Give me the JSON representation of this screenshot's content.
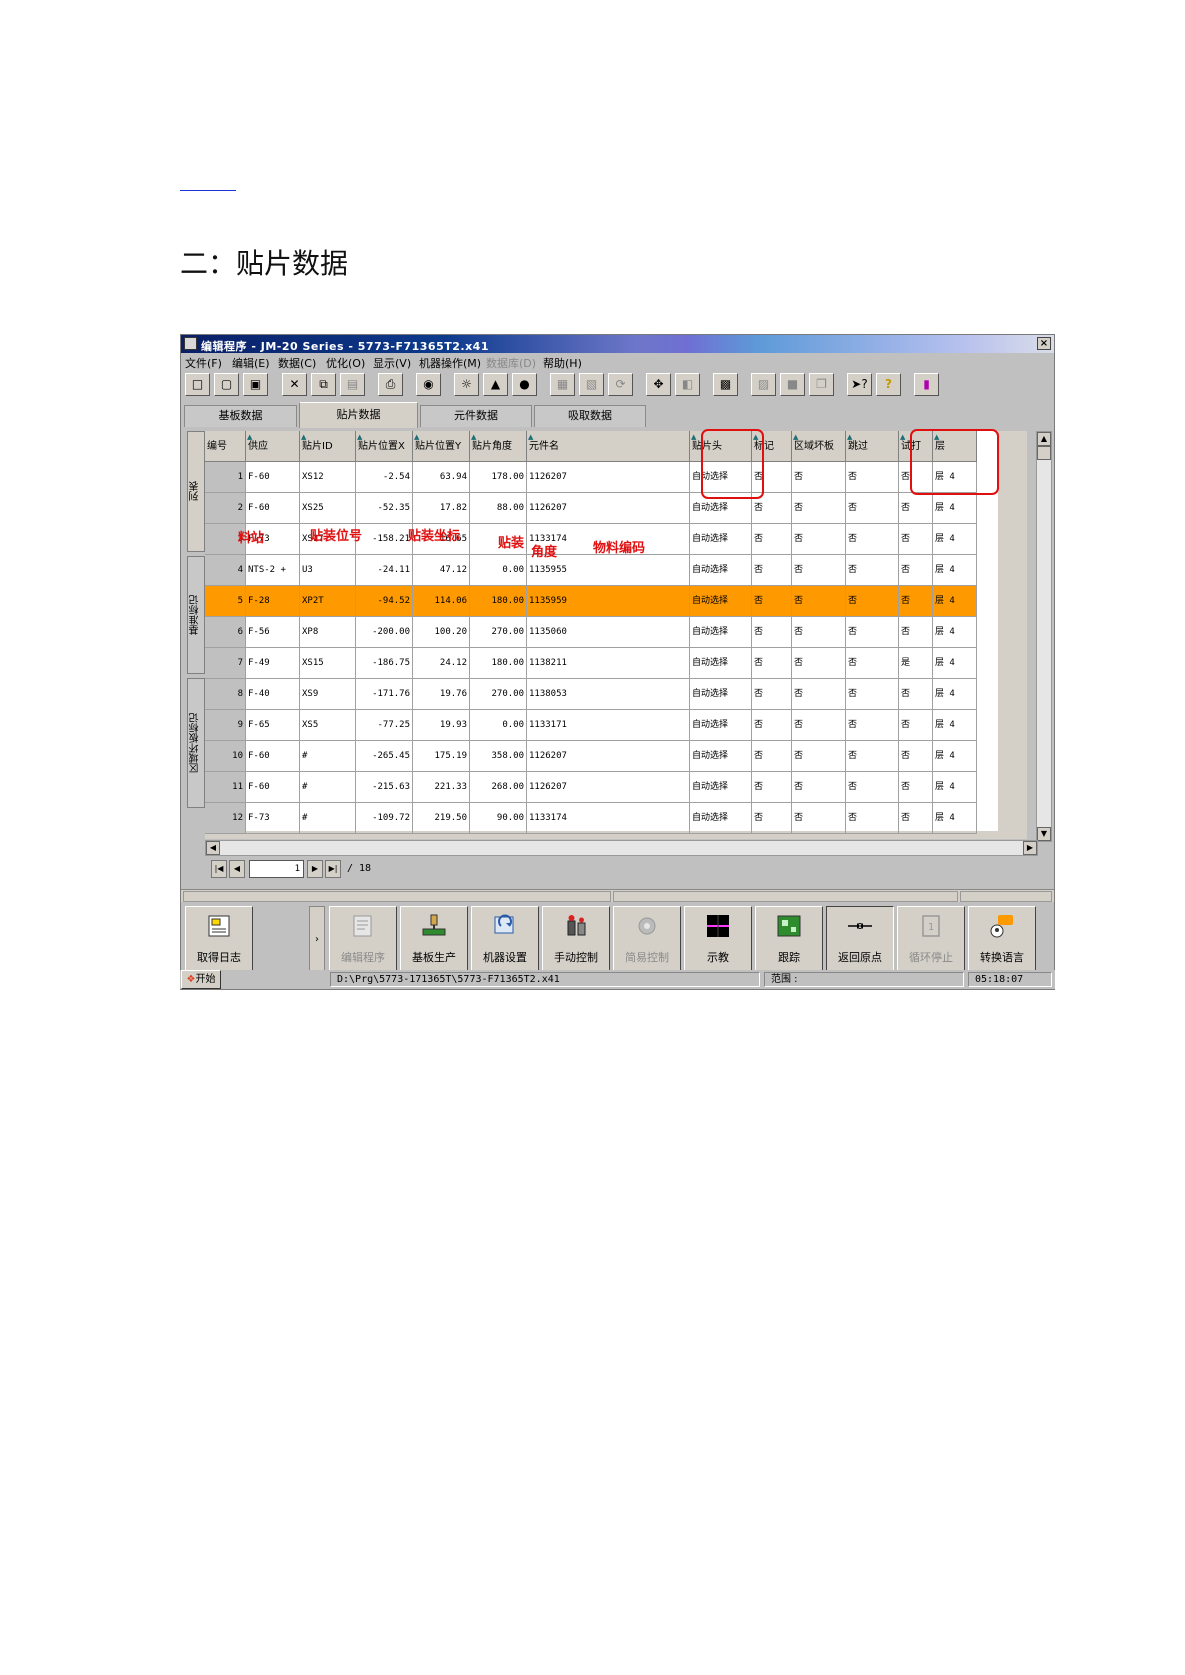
{
  "section_heading": "二：贴片数据",
  "window": {
    "title": "编辑程序 - JM-20 Series - 5773-F71365T2.x41",
    "close_glyph": "×"
  },
  "menu": [
    "文件(F)",
    "编辑(E)",
    "数据(C)",
    "优化(O)",
    "显示(V)",
    "机器操作(M)",
    "数据库(D)",
    "帮助(H)"
  ],
  "tabs": [
    "基板数据",
    "贴片数据",
    "元件数据",
    "吸取数据"
  ],
  "active_tab": "贴片数据",
  "side_tabs": [
    "列表",
    "基准标记",
    "区域坏板标记"
  ],
  "columns": [
    "编号",
    "供应",
    "贴片ID",
    "贴片位置X",
    "贴片位置Y",
    "贴片角度",
    "元件名",
    "贴片头",
    "标记",
    "区域坏板",
    "跳过",
    "试打",
    "层"
  ],
  "rows": [
    [
      "1",
      "F-60",
      "XS12",
      "-2.54",
      "63.94",
      "178.00",
      "1126207",
      "自动选择",
      "否",
      "否",
      "否",
      "否",
      "层 4"
    ],
    [
      "2",
      "F-60",
      "XS25",
      "-52.35",
      "17.82",
      "88.00",
      "1126207",
      "自动选择",
      "否",
      "否",
      "否",
      "否",
      "层 4"
    ],
    [
      "3",
      "F-73",
      "XS17",
      "-158.21",
      "16.65",
      "",
      "1133174",
      "自动选择",
      "否",
      "否",
      "否",
      "否",
      "层 4"
    ],
    [
      "4",
      "NTS-2 +",
      "U3",
      "-24.11",
      "47.12",
      "0.00",
      "1135955",
      "自动选择",
      "否",
      "否",
      "否",
      "否",
      "层 4"
    ],
    [
      "5",
      "F-28",
      "XP2T",
      "-94.52",
      "114.06",
      "180.00",
      "1135959",
      "自动选择",
      "否",
      "否",
      "否",
      "否",
      "层 4"
    ],
    [
      "6",
      "F-56",
      "XP8",
      "-200.00",
      "100.20",
      "270.00",
      "1135060",
      "自动选择",
      "否",
      "否",
      "否",
      "否",
      "层 4"
    ],
    [
      "7",
      "F-49",
      "XS15",
      "-186.75",
      "24.12",
      "180.00",
      "1138211",
      "自动选择",
      "否",
      "否",
      "否",
      "是",
      "层 4"
    ],
    [
      "8",
      "F-40",
      "XS9",
      "-171.76",
      "19.76",
      "270.00",
      "1138053",
      "自动选择",
      "否",
      "否",
      "否",
      "否",
      "层 4"
    ],
    [
      "9",
      "F-65",
      "XS5",
      "-77.25",
      "19.93",
      "0.00",
      "1133171",
      "自动选择",
      "否",
      "否",
      "否",
      "否",
      "层 4"
    ],
    [
      "10",
      "F-60",
      "#",
      "-265.45",
      "175.19",
      "358.00",
      "1126207",
      "自动选择",
      "否",
      "否",
      "否",
      "否",
      "层 4"
    ],
    [
      "11",
      "F-60",
      "#",
      "-215.63",
      "221.33",
      "268.00",
      "1126207",
      "自动选择",
      "否",
      "否",
      "否",
      "否",
      "层 4"
    ],
    [
      "12",
      "F-73",
      "#",
      "-109.72",
      "219.50",
      "90.00",
      "1133174",
      "自动选择",
      "否",
      "否",
      "否",
      "否",
      "层 4"
    ]
  ],
  "selected_row": 5,
  "annotations": [
    "料站",
    "贴装位号",
    "贴装坐标",
    "贴装",
    "角度",
    "物料编码"
  ],
  "pager": {
    "page": "1",
    "total": "/ 18"
  },
  "bottom_buttons": [
    {
      "label": "取得日志",
      "icon": "log-icon",
      "enabled": true
    },
    {
      "label": "编辑程序",
      "icon": "edit-program-icon",
      "enabled": false
    },
    {
      "label": "基板生产",
      "icon": "production-icon",
      "enabled": true
    },
    {
      "label": "机器设置",
      "icon": "machine-setup-icon",
      "enabled": true
    },
    {
      "label": "手动控制",
      "icon": "manual-control-icon",
      "enabled": true
    },
    {
      "label": "简易控制",
      "icon": "simple-control-icon",
      "enabled": false
    },
    {
      "label": "示教",
      "icon": "teach-icon",
      "enabled": true
    },
    {
      "label": "跟踪",
      "icon": "trace-icon",
      "enabled": true
    },
    {
      "label": "返回原点",
      "icon": "return-origin-icon",
      "enabled": true
    },
    {
      "label": "循环停止",
      "icon": "cycle-stop-icon",
      "enabled": false
    },
    {
      "label": "转换语言",
      "icon": "language-icon",
      "enabled": true
    }
  ],
  "status": {
    "start": "开始",
    "path": "D:\\Prg\\5773-171365T\\5773-F71365T2.x41",
    "range_label": "范围 :",
    "time": "05:18:07"
  },
  "colors": {
    "selected_row": "#ff9900",
    "annotation": "#e01010"
  }
}
